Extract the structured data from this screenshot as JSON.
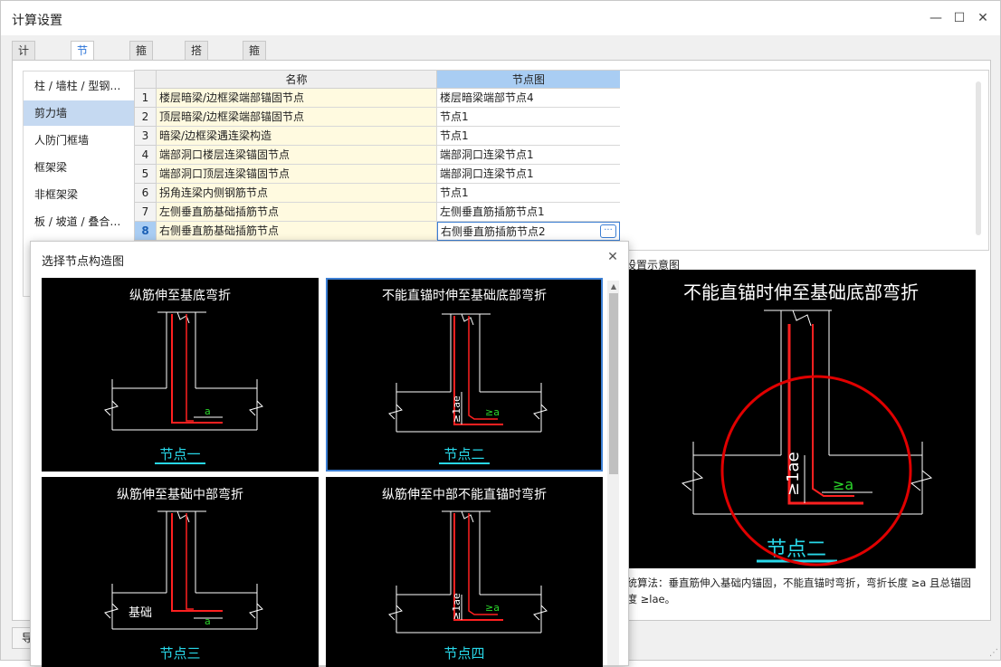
{
  "window": {
    "title": "计算设置",
    "minimize": "—",
    "maximize": "☐",
    "close": "✕"
  },
  "tabs": [
    "计算规则",
    "节点设置",
    "箍筋设置",
    "搭接设置",
    "箍筋公式"
  ],
  "active_tab": "节点设置",
  "leftnav": {
    "items": [
      "柱 / 墙柱 / 型钢…",
      "剪力墙",
      "人防门框墙",
      "框架梁",
      "非框架梁",
      "板 / 坡道 / 叠合…"
    ],
    "selected": "剪力墙"
  },
  "grid": {
    "headers": {
      "name": "名称",
      "node": "节点图"
    },
    "rows": [
      {
        "num": "1",
        "name": "楼层暗梁/边框梁端部锚固节点",
        "node": "楼层暗梁端部节点4"
      },
      {
        "num": "2",
        "name": "顶层暗梁/边框梁端部锚固节点",
        "node": "节点1"
      },
      {
        "num": "3",
        "name": "暗梁/边框梁遇连梁构造",
        "node": "节点1"
      },
      {
        "num": "4",
        "name": "端部洞口楼层连梁锚固节点",
        "node": "端部洞口连梁节点1"
      },
      {
        "num": "5",
        "name": "端部洞口顶层连梁锚固节点",
        "node": "端部洞口连梁节点1"
      },
      {
        "num": "6",
        "name": "拐角连梁内侧钢筋节点",
        "node": "节点1"
      },
      {
        "num": "7",
        "name": "左侧垂直筋基础插筋节点",
        "node": "左侧垂直筋插筋节点1"
      },
      {
        "num": "8",
        "name": "右侧垂直筋基础插筋节点",
        "node": "右侧垂直筋插筋节点2"
      }
    ],
    "ellipsis": "···"
  },
  "preview": {
    "label": "点设置示意图",
    "title": "不能直锚时伸至基础底部弯折",
    "node_label": "节点二",
    "dim_lae": "≥1ae",
    "dim_a": "≥a"
  },
  "description": "传统算法：垂直筋伸入基础内锚固，不能直锚时弯折，弯折长度 ≥a 且总锚固长度 ≥lae。",
  "bottom_button": "导",
  "dialog": {
    "title": "选择节点构造图",
    "close": "✕",
    "cards": [
      {
        "title": "纵筋伸至基底弯折",
        "node_label": "节点一",
        "dim_a": "a",
        "base_label": "",
        "dim_lae": ""
      },
      {
        "title": "不能直锚时伸至基础底部弯折",
        "node_label": "节点二",
        "dim_a": "≥a",
        "base_label": "",
        "dim_lae": "≥1ae"
      },
      {
        "title": "纵筋伸至基础中部弯折",
        "node_label": "节点三",
        "dim_a": "a",
        "base_label": "基础",
        "dim_lae": ""
      },
      {
        "title": "纵筋伸至中部不能直锚时弯折",
        "node_label": "节点四",
        "dim_a": "≥a",
        "base_label": "",
        "dim_lae": "≥1ae"
      }
    ],
    "selected_card": 1
  },
  "colors": {
    "accent": "#3c7fd4",
    "rebar": "#ff2020",
    "node_text": "#28d7e8",
    "dim_text": "#2bd62b",
    "highlight_circle": "#e00000",
    "name_cell_bg": "#fffae0",
    "header_selected_bg": "#a9cdf3"
  }
}
